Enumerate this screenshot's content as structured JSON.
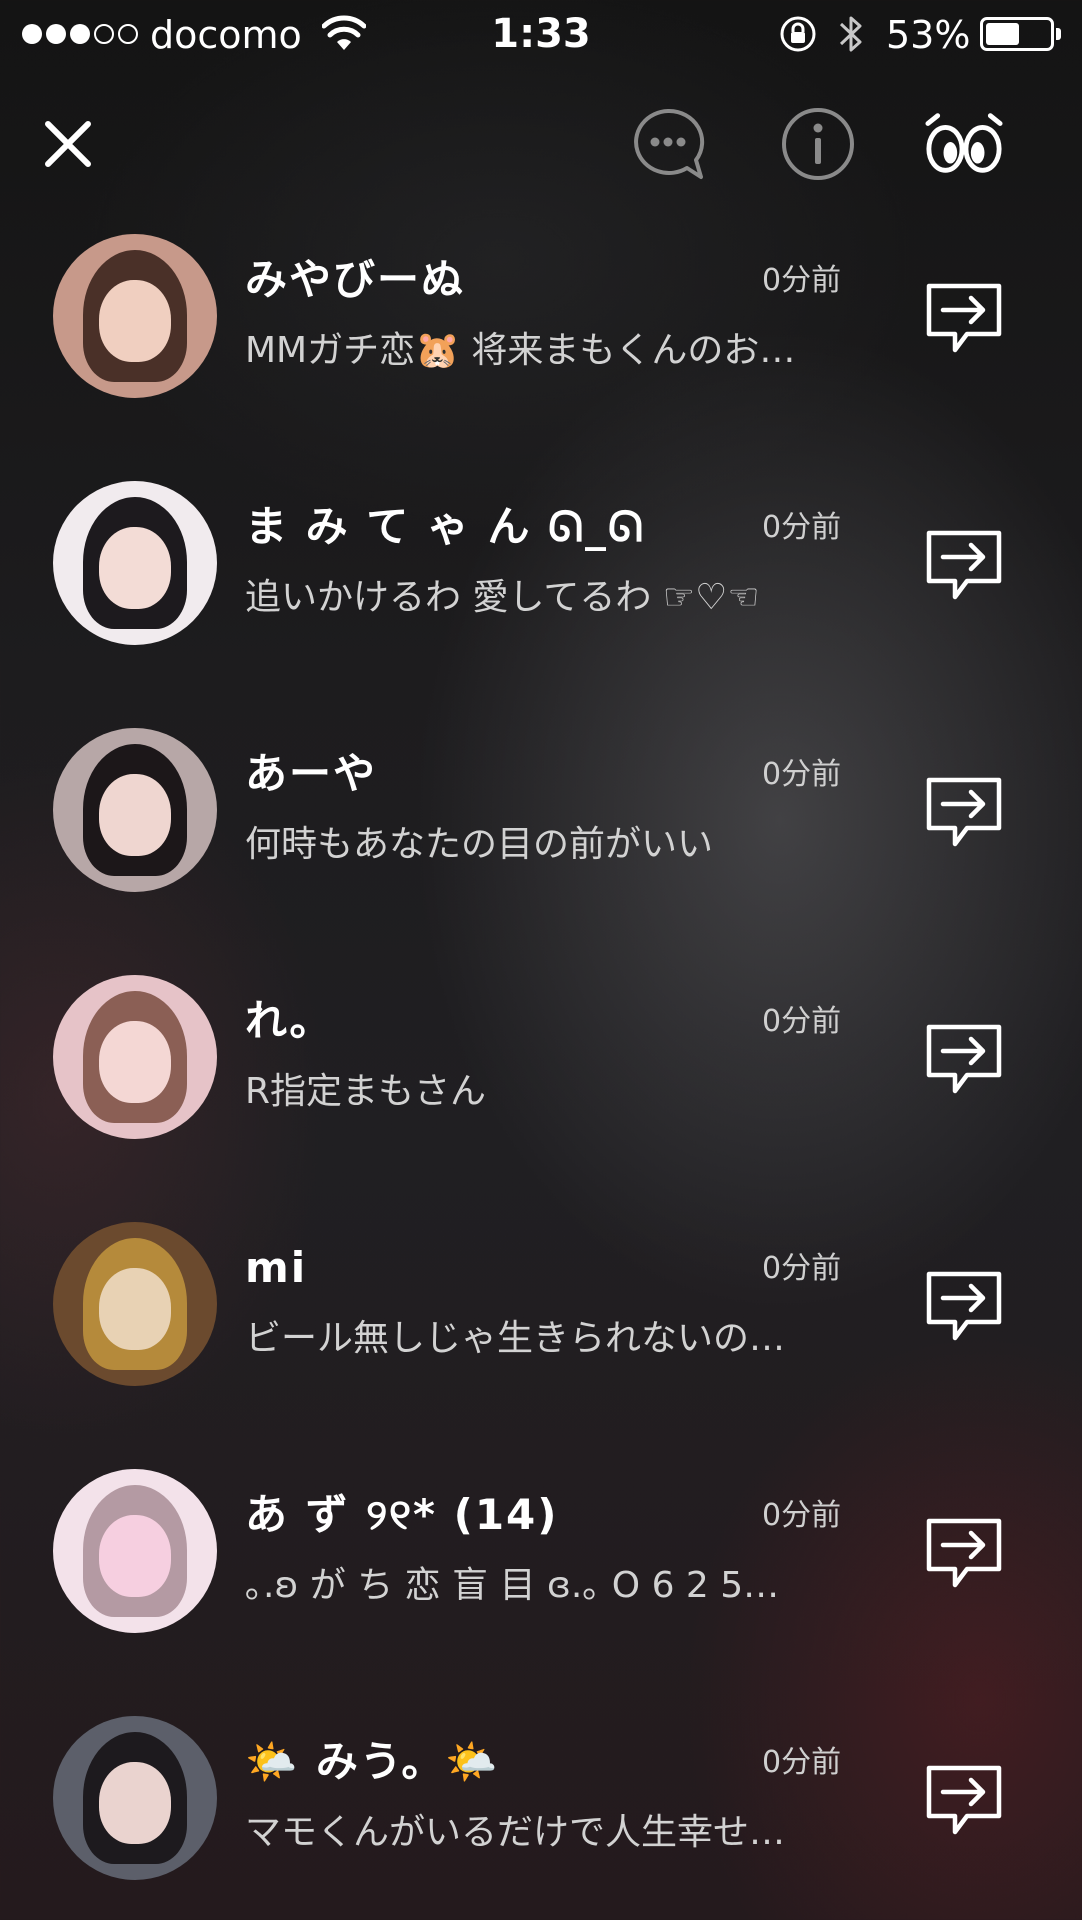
{
  "status_bar": {
    "signal_dots": [
      "full",
      "full",
      "full",
      "empty",
      "empty"
    ],
    "carrier": "docomo",
    "time": "1:33",
    "battery_text": "53%",
    "battery_level": 0.53
  },
  "toolbar": {
    "close_icon": "close-icon",
    "chat_icon": "chat-bubble-icon",
    "info_icon": "info-icon",
    "eyes_icon": "eyes-icon"
  },
  "users": [
    {
      "name": "みやびーぬ",
      "time": "0分前",
      "message": "MMガチ恋🐹 将来まもくんのお…",
      "avatar_bg": "#c7998a",
      "hair": "#4a3028",
      "face": "#f0cfc0"
    },
    {
      "name": "ま み て ゃ ん ᘏ_ᘏ",
      "time": "0分前",
      "message": "追いかけるわ 愛してるわ ☞♡☜",
      "avatar_bg": "#f1ebee",
      "hair": "#1d1a1e",
      "face": "#f3dcd6"
    },
    {
      "name": "あーや",
      "time": "0分前",
      "message": "何時もあなたの目の前がいい",
      "avatar_bg": "#b7a7a7",
      "hair": "#1c1719",
      "face": "#efd6d0"
    },
    {
      "name": "れ。",
      "time": "0分前",
      "message": "R指定まもさん",
      "avatar_bg": "#e6c3c8",
      "hair": "#8b5f55",
      "face": "#f4d7d4"
    },
    {
      "name": "mi",
      "time": "0分前",
      "message": "ビール無しじゃ生きられないの…",
      "avatar_bg": "#6b4a2e",
      "hair": "#b58a3b",
      "face": "#e8d2b4"
    },
    {
      "name": "あ ず ୨୧* (14)",
      "time": "0分前",
      "message": "｡.ʚ が ち 恋 盲 目 ɞ.｡ O 6 2 5…",
      "avatar_bg": "#f3e2ea",
      "hair": "#b49aa3",
      "face": "#f6cfe0"
    },
    {
      "name": "🌤️ みう。🌤️",
      "time": "0分前",
      "message": "マモくんがいるだけで人生幸せ…",
      "avatar_bg": "#5c5f6a",
      "hair": "#1d1a1e",
      "face": "#ead3cf"
    }
  ],
  "icons": {
    "share": "share-arrow-icon"
  }
}
